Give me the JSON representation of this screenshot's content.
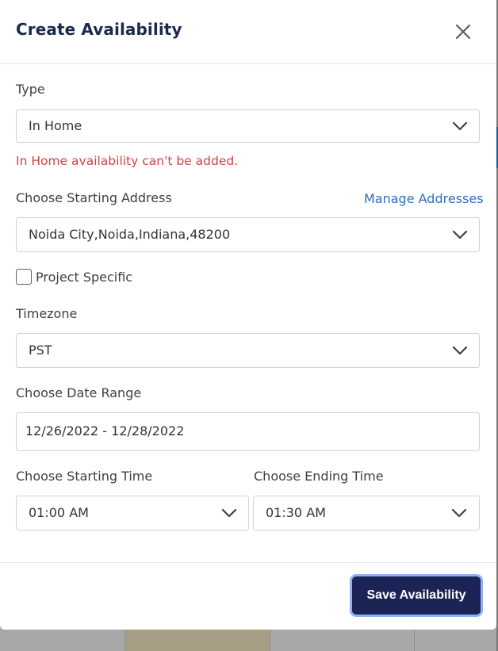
{
  "modal": {
    "title": "Create Availability",
    "close_icon": "close-icon"
  },
  "type": {
    "label": "Type",
    "value": "In Home",
    "error": "In Home availability can't be added."
  },
  "starting_address": {
    "label": "Choose Starting Address",
    "manage_link": "Manage Addresses",
    "value": "Noida City,Noida,Indiana,48200"
  },
  "project_specific": {
    "label": "Project Specific",
    "checked": false
  },
  "timezone": {
    "label": "Timezone",
    "value": "PST"
  },
  "date_range": {
    "label": "Choose Date Range",
    "value": "12/26/2022 - 12/28/2022"
  },
  "starting_time": {
    "label": "Choose Starting Time",
    "value": "01:00 AM"
  },
  "ending_time": {
    "label": "Choose Ending Time",
    "value": "01:30 AM"
  },
  "footer": {
    "save_label": "Save Availability"
  },
  "colors": {
    "primary_button": "#1c2456",
    "error": "#d34242",
    "link": "#2c6fbf"
  }
}
